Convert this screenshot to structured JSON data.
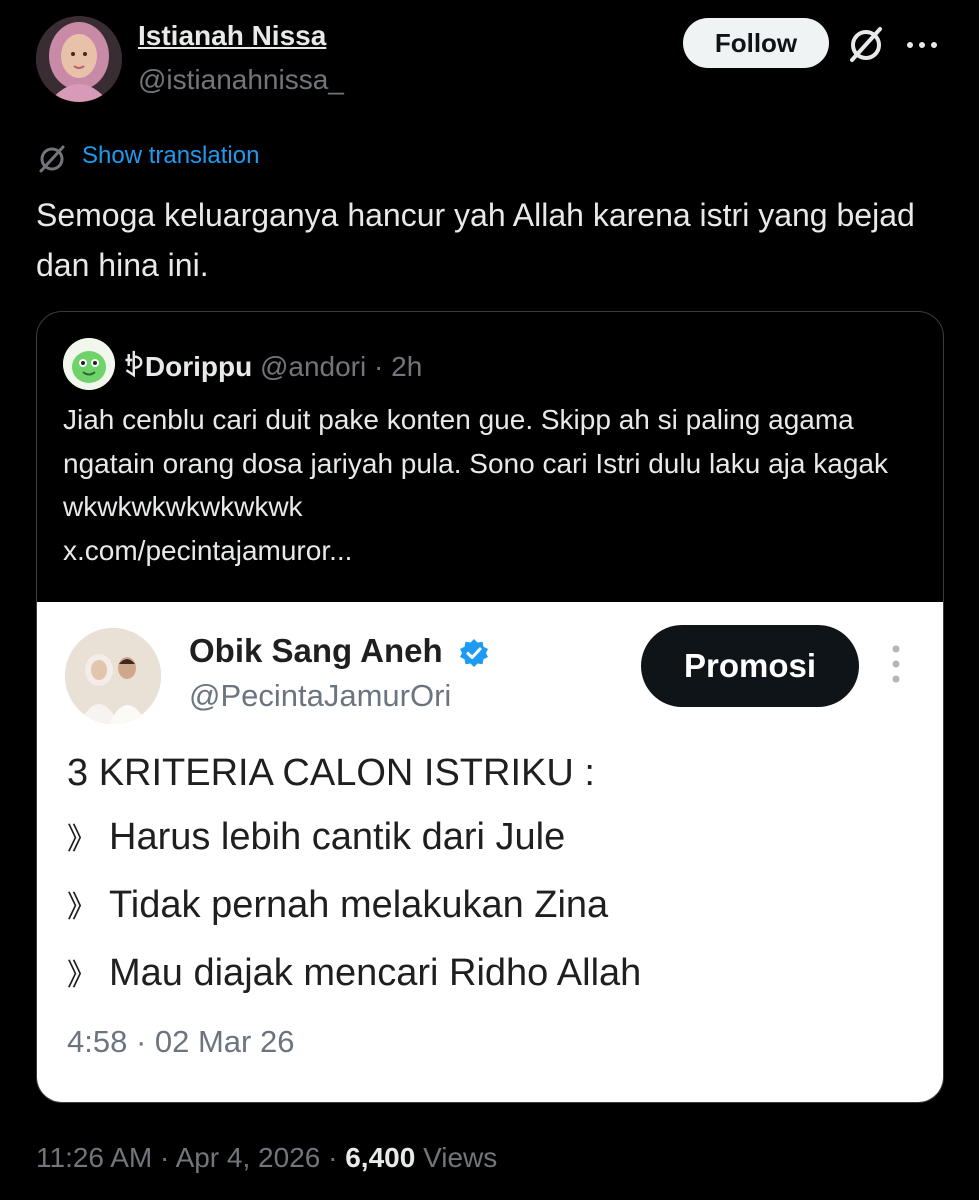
{
  "author": {
    "name": "Istianah Nissa",
    "handle": "@istianahnissa_",
    "follow_label": "Follow"
  },
  "translation": {
    "label": "Show translation"
  },
  "tweet": {
    "text": "Semoga keluarganya hancur yah Allah karena istri yang bejad dan hina ini."
  },
  "quote": {
    "name": "ꉣDorippu",
    "handle": "@andori",
    "time": "· 2h",
    "text": "Jiah cenblu cari duit pake konten gue. Skipp ah si paling agama ngatain orang dosa jariyah pula. Sono cari Istri dulu laku aja kagak wkwkwkwkwkwkwk",
    "link": "x.com/pecintajamuror..."
  },
  "inner": {
    "name": "Obik Sang Aneh",
    "handle": "@PecintaJamurOri",
    "button_label": "Promosi",
    "title": "3 KRITERIA CALON ISTRIKU :",
    "bullet": "》",
    "criteria": [
      "Harus lebih cantik dari Jule",
      "Tidak pernah melakukan Zina",
      "Mau diajak mencari Ridho Allah"
    ],
    "date": "4:58 · 02 Mar 26"
  },
  "footer": {
    "time": "11:26 AM · Apr 4, 2026 · ",
    "views_count": "6,400",
    "views_label": " Views"
  },
  "colors": {
    "background": "#000000",
    "accent": "#1d9bf0",
    "verified": "#1d9bf0",
    "muted": "#71767b"
  },
  "icons": [
    "grok-icon",
    "more-icon",
    "translate-icon",
    "verified-badge-icon",
    "more-vertical-icon"
  ]
}
